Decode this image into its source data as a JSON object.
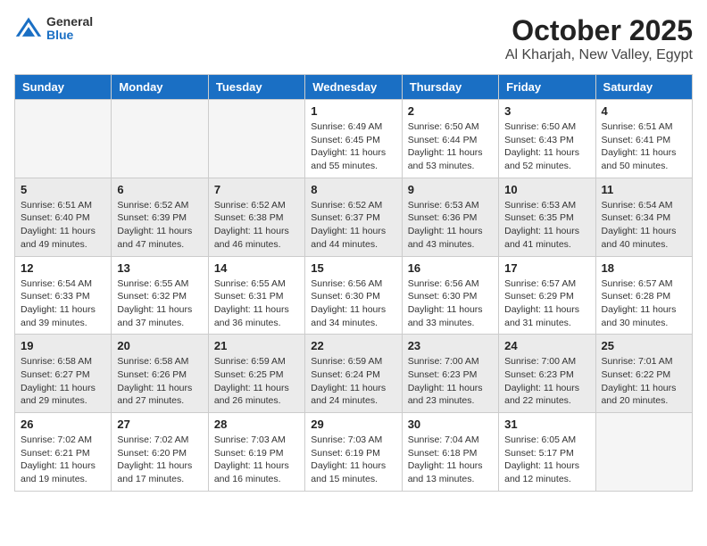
{
  "logo": {
    "general": "General",
    "blue": "Blue"
  },
  "header": {
    "month": "October 2025",
    "location": "Al Kharjah, New Valley, Egypt"
  },
  "days_of_week": [
    "Sunday",
    "Monday",
    "Tuesday",
    "Wednesday",
    "Thursday",
    "Friday",
    "Saturday"
  ],
  "weeks": [
    [
      {
        "day": "",
        "info": ""
      },
      {
        "day": "",
        "info": ""
      },
      {
        "day": "",
        "info": ""
      },
      {
        "day": "1",
        "info": "Sunrise: 6:49 AM\nSunset: 6:45 PM\nDaylight: 11 hours and 55 minutes."
      },
      {
        "day": "2",
        "info": "Sunrise: 6:50 AM\nSunset: 6:44 PM\nDaylight: 11 hours and 53 minutes."
      },
      {
        "day": "3",
        "info": "Sunrise: 6:50 AM\nSunset: 6:43 PM\nDaylight: 11 hours and 52 minutes."
      },
      {
        "day": "4",
        "info": "Sunrise: 6:51 AM\nSunset: 6:41 PM\nDaylight: 11 hours and 50 minutes."
      }
    ],
    [
      {
        "day": "5",
        "info": "Sunrise: 6:51 AM\nSunset: 6:40 PM\nDaylight: 11 hours and 49 minutes."
      },
      {
        "day": "6",
        "info": "Sunrise: 6:52 AM\nSunset: 6:39 PM\nDaylight: 11 hours and 47 minutes."
      },
      {
        "day": "7",
        "info": "Sunrise: 6:52 AM\nSunset: 6:38 PM\nDaylight: 11 hours and 46 minutes."
      },
      {
        "day": "8",
        "info": "Sunrise: 6:52 AM\nSunset: 6:37 PM\nDaylight: 11 hours and 44 minutes."
      },
      {
        "day": "9",
        "info": "Sunrise: 6:53 AM\nSunset: 6:36 PM\nDaylight: 11 hours and 43 minutes."
      },
      {
        "day": "10",
        "info": "Sunrise: 6:53 AM\nSunset: 6:35 PM\nDaylight: 11 hours and 41 minutes."
      },
      {
        "day": "11",
        "info": "Sunrise: 6:54 AM\nSunset: 6:34 PM\nDaylight: 11 hours and 40 minutes."
      }
    ],
    [
      {
        "day": "12",
        "info": "Sunrise: 6:54 AM\nSunset: 6:33 PM\nDaylight: 11 hours and 39 minutes."
      },
      {
        "day": "13",
        "info": "Sunrise: 6:55 AM\nSunset: 6:32 PM\nDaylight: 11 hours and 37 minutes."
      },
      {
        "day": "14",
        "info": "Sunrise: 6:55 AM\nSunset: 6:31 PM\nDaylight: 11 hours and 36 minutes."
      },
      {
        "day": "15",
        "info": "Sunrise: 6:56 AM\nSunset: 6:30 PM\nDaylight: 11 hours and 34 minutes."
      },
      {
        "day": "16",
        "info": "Sunrise: 6:56 AM\nSunset: 6:30 PM\nDaylight: 11 hours and 33 minutes."
      },
      {
        "day": "17",
        "info": "Sunrise: 6:57 AM\nSunset: 6:29 PM\nDaylight: 11 hours and 31 minutes."
      },
      {
        "day": "18",
        "info": "Sunrise: 6:57 AM\nSunset: 6:28 PM\nDaylight: 11 hours and 30 minutes."
      }
    ],
    [
      {
        "day": "19",
        "info": "Sunrise: 6:58 AM\nSunset: 6:27 PM\nDaylight: 11 hours and 29 minutes."
      },
      {
        "day": "20",
        "info": "Sunrise: 6:58 AM\nSunset: 6:26 PM\nDaylight: 11 hours and 27 minutes."
      },
      {
        "day": "21",
        "info": "Sunrise: 6:59 AM\nSunset: 6:25 PM\nDaylight: 11 hours and 26 minutes."
      },
      {
        "day": "22",
        "info": "Sunrise: 6:59 AM\nSunset: 6:24 PM\nDaylight: 11 hours and 24 minutes."
      },
      {
        "day": "23",
        "info": "Sunrise: 7:00 AM\nSunset: 6:23 PM\nDaylight: 11 hours and 23 minutes."
      },
      {
        "day": "24",
        "info": "Sunrise: 7:00 AM\nSunset: 6:23 PM\nDaylight: 11 hours and 22 minutes."
      },
      {
        "day": "25",
        "info": "Sunrise: 7:01 AM\nSunset: 6:22 PM\nDaylight: 11 hours and 20 minutes."
      }
    ],
    [
      {
        "day": "26",
        "info": "Sunrise: 7:02 AM\nSunset: 6:21 PM\nDaylight: 11 hours and 19 minutes."
      },
      {
        "day": "27",
        "info": "Sunrise: 7:02 AM\nSunset: 6:20 PM\nDaylight: 11 hours and 17 minutes."
      },
      {
        "day": "28",
        "info": "Sunrise: 7:03 AM\nSunset: 6:19 PM\nDaylight: 11 hours and 16 minutes."
      },
      {
        "day": "29",
        "info": "Sunrise: 7:03 AM\nSunset: 6:19 PM\nDaylight: 11 hours and 15 minutes."
      },
      {
        "day": "30",
        "info": "Sunrise: 7:04 AM\nSunset: 6:18 PM\nDaylight: 11 hours and 13 minutes."
      },
      {
        "day": "31",
        "info": "Sunrise: 6:05 AM\nSunset: 5:17 PM\nDaylight: 11 hours and 12 minutes."
      },
      {
        "day": "",
        "info": ""
      }
    ]
  ]
}
